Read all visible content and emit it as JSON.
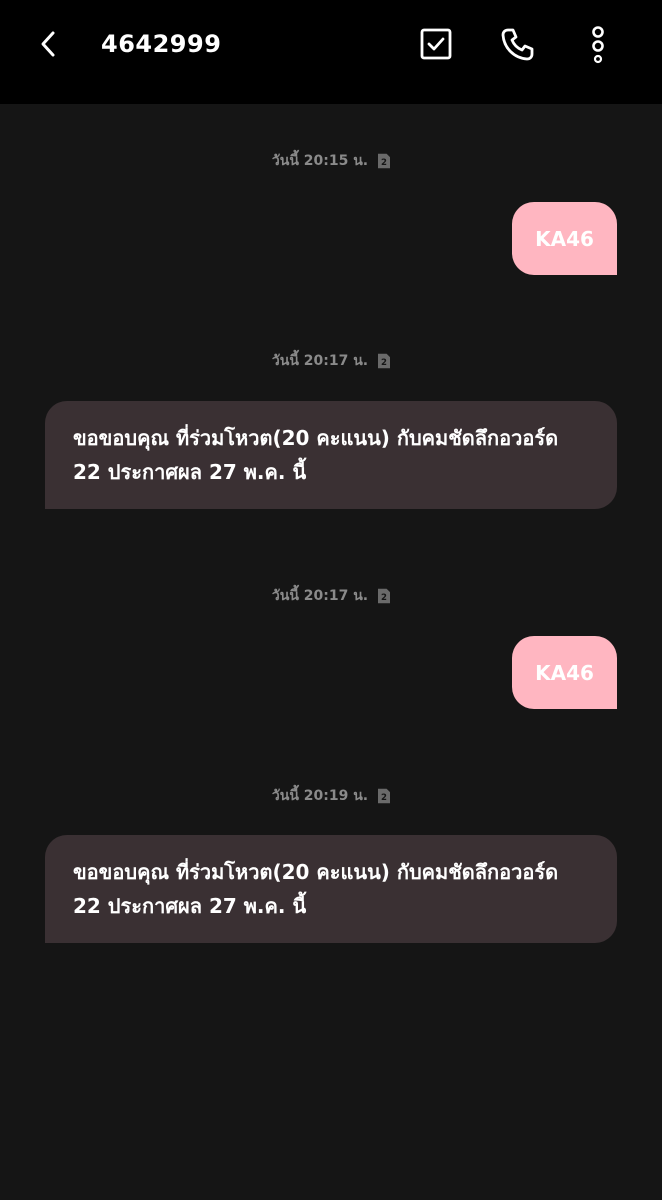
{
  "header": {
    "title": "4642999",
    "back_icon": "chevron-left-icon",
    "select_icon": "checkbox-icon",
    "call_icon": "phone-icon",
    "more_icon": "more-vertical-icon"
  },
  "colors": {
    "background": "#151515",
    "topbar": "#000000",
    "outgoing_bubble": "#ffb6c1",
    "incoming_bubble": "#3a3033",
    "timestamp_text": "#8a8a8a"
  },
  "messages": [
    {
      "timestamp": "วันนี้ 20:15 น.",
      "sim": "2",
      "direction": "outgoing",
      "text": "KA46"
    },
    {
      "timestamp": "วันนี้ 20:17 น.",
      "sim": "2",
      "direction": "incoming",
      "text": "ขอขอบคุณ ที่ร่วมโหวต(20 คะแนน) กับคมชัดลึกอวอร์ด 22 ประกาศผล 27 พ.ค. นี้"
    },
    {
      "timestamp": "วันนี้ 20:17 น.",
      "sim": "2",
      "direction": "outgoing",
      "text": "KA46"
    },
    {
      "timestamp": "วันนี้ 20:19 น.",
      "sim": "2",
      "direction": "incoming",
      "text": "ขอขอบคุณ ที่ร่วมโหวต(20 คะแนน) กับคมชัดลึกอวอร์ด 22 ประกาศผล 27 พ.ค. นี้"
    }
  ]
}
